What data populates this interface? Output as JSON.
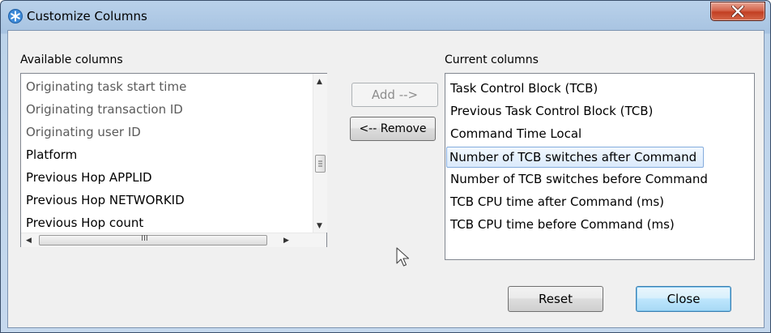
{
  "window": {
    "title": "Customize Columns",
    "close_icon": "close-icon"
  },
  "available": {
    "label": "Available columns",
    "items": [
      "Originating task start time",
      "Originating transaction ID",
      "Originating user ID",
      "Platform",
      "Previous Hop APPLID",
      "Previous Hop NETWORKID",
      "Previous Hop count"
    ],
    "hscroll_grip": "III"
  },
  "current": {
    "label": "Current columns",
    "items": [
      "Task Control Block (TCB)",
      "Previous Task Control Block (TCB)",
      "Command Time Local",
      "Number of TCB switches after Command",
      "Number of TCB switches before Command",
      "TCB CPU time after Command (ms)",
      "TCB CPU time before Command (ms)"
    ],
    "selected_index": 3
  },
  "buttons": {
    "add": "Add -->",
    "remove": "<-- Remove",
    "reset": "Reset",
    "close": "Close"
  }
}
